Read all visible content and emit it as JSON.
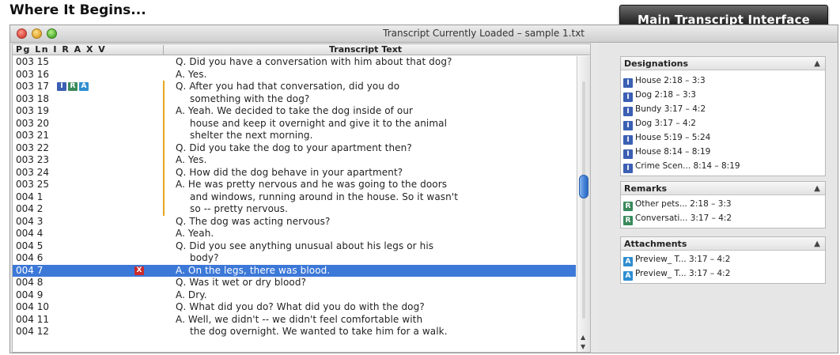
{
  "heading": "Where It Begins...",
  "main_badge": "Main Transcript Interface",
  "window": {
    "title": "Transcript Currently Loaded – sample 1.txt"
  },
  "transcript": {
    "headers": {
      "codes": "Pg Ln I R A X V",
      "text": "Transcript Text"
    },
    "rows": [
      {
        "pg_ln": "003 15",
        "text": "Q.  Did you have a conversation with him about that dog?"
      },
      {
        "pg_ln": "003 16",
        "text": "A.  Yes."
      },
      {
        "pg_ln": "003 17",
        "text": "Q.  After you had that conversation, did you do"
      },
      {
        "pg_ln": "003 18",
        "text": "something with the dog?"
      },
      {
        "pg_ln": "003 19",
        "text": "A.  Yeah.  We decided to take the dog inside of our"
      },
      {
        "pg_ln": "003 20",
        "text": "house and keep it overnight and give it to the animal"
      },
      {
        "pg_ln": "003 21",
        "text": "shelter the next morning."
      },
      {
        "pg_ln": "003 22",
        "text": "Q.  Did you take the dog to your apartment then?"
      },
      {
        "pg_ln": "003 23",
        "text": "A.  Yes."
      },
      {
        "pg_ln": "003 24",
        "text": "Q.  How did the dog behave in your apartment?"
      },
      {
        "pg_ln": "003 25",
        "text": "A.  He was pretty nervous and he was going to the doors"
      },
      {
        "pg_ln": "004  1",
        "text": "and windows, running around in the house.  So it wasn't"
      },
      {
        "pg_ln": "004  2",
        "text": "so -- pretty nervous."
      },
      {
        "pg_ln": "004  3",
        "text": "Q.  The dog was acting nervous?"
      },
      {
        "pg_ln": "004  4",
        "text": "A.  Yeah."
      },
      {
        "pg_ln": "004  5",
        "text": "Q.  Did you see anything unusual about his legs or his"
      },
      {
        "pg_ln": "004  6",
        "text": "body?"
      },
      {
        "pg_ln": "004  7",
        "text": "A.  On the legs, there was blood."
      },
      {
        "pg_ln": "004  8",
        "text": "Q.  Was it wet or dry blood?"
      },
      {
        "pg_ln": "004  9",
        "text": "A.  Dry."
      },
      {
        "pg_ln": "004 10",
        "text": "Q.  What did you do?  What did you do with the dog?"
      },
      {
        "pg_ln": "004 11",
        "text": "A.  Well, we didn't -- we didn't feel comfortable with"
      },
      {
        "pg_ln": "004 12",
        "text": "the dog overnight.  We wanted to take him for a walk."
      }
    ],
    "codes": {
      "I": "I",
      "R": "R",
      "A": "A",
      "X": "X"
    }
  },
  "designations": {
    "title": "Designations",
    "items": [
      {
        "tag": "I",
        "label": "House 2:18 – 3:3"
      },
      {
        "tag": "I",
        "label": "Dog 2:18 – 3:3"
      },
      {
        "tag": "I",
        "label": "Bundy 3:17 – 4:2"
      },
      {
        "tag": "I",
        "label": "Dog 3:17 – 4:2"
      },
      {
        "tag": "I",
        "label": "House 5:19 – 5:24"
      },
      {
        "tag": "I",
        "label": "House 8:14 – 8:19"
      },
      {
        "tag": "I",
        "label": "Crime Scen... 8:14 – 8:19"
      }
    ]
  },
  "remarks": {
    "title": "Remarks",
    "items": [
      {
        "tag": "R",
        "label": "Other pets... 2:18 – 3:3"
      },
      {
        "tag": "R",
        "label": "Conversati... 3:17 – 4:2"
      }
    ]
  },
  "attachments": {
    "title": "Attachments",
    "items": [
      {
        "tag": "A",
        "label": "Preview_ T... 3:17 – 4:2"
      },
      {
        "tag": "A",
        "label": "Preview_ T... 3:17 – 4:2"
      }
    ]
  },
  "colors": {
    "selection": "#3c78d8",
    "designation_tag": "#3b5fb3",
    "remark_tag": "#3a8a5c",
    "attachment_tag": "#2f8ed0",
    "exclusion_tag": "#cc2a2a",
    "bracket": "#e4a71f"
  }
}
